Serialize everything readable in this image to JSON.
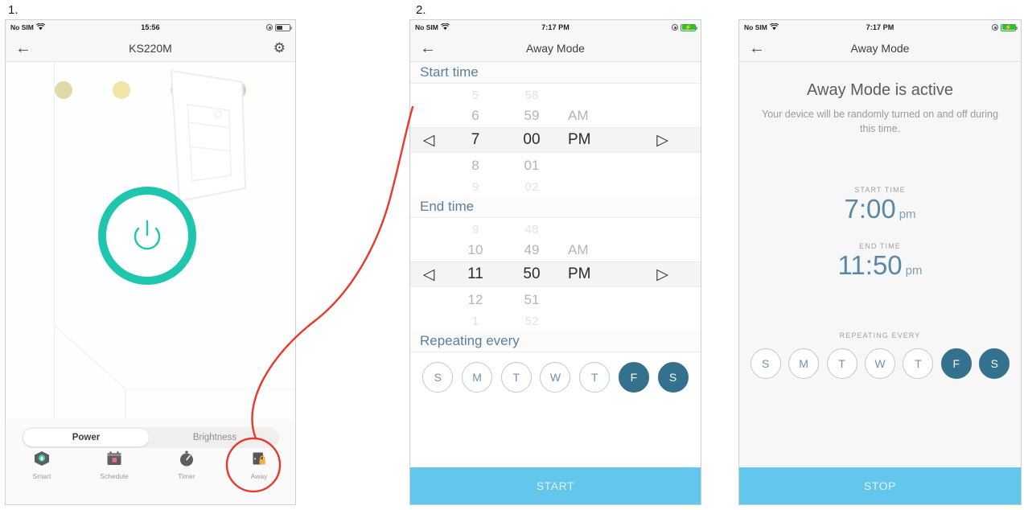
{
  "steps": [
    {
      "label": "1."
    },
    {
      "label": "2."
    }
  ],
  "accent": {
    "teal": "#1fc5ac",
    "blue_header": "#5b7f9c",
    "day_on": "#34718f",
    "cta": "#63c6ec",
    "annotation_red": "#e8392c",
    "time_blue": "#5b87a8"
  },
  "screen1": {
    "status": {
      "carrier": "No SIM",
      "wifi_icon": "wifi-icon",
      "time": "15:56",
      "location_icon": "location-icon",
      "battery_icon": "battery-icon",
      "battery_level": 40
    },
    "nav": {
      "back_icon": "back-arrow-icon",
      "title": "KS220M",
      "settings_icon": "gear-icon"
    },
    "illustration": {
      "device_icon": "wall-outlet-illustration",
      "power_icon": "power-symbol-icon",
      "dots": [
        "#e2d9a8",
        "#f2e3a6",
        "#eadfa6",
        "#d6d3bb"
      ]
    },
    "segmented": {
      "options": [
        "Power",
        "Brightness"
      ],
      "selected": "Power"
    },
    "tabs": [
      {
        "label": "Smart",
        "icon": "smart-cube-icon"
      },
      {
        "label": "Schedule",
        "icon": "calendar-icon"
      },
      {
        "label": "Timer",
        "icon": "stopwatch-icon"
      },
      {
        "label": "Away",
        "icon": "away-lock-icon"
      }
    ],
    "highlighted_tab": "Away"
  },
  "screen2": {
    "status": {
      "carrier": "No SIM",
      "wifi_icon": "wifi-icon",
      "time": "7:17 PM",
      "location_icon": "location-icon",
      "battery_icon": "battery-charging-icon"
    },
    "nav": {
      "back_icon": "back-arrow-icon",
      "title": "Away Mode"
    },
    "start_time": {
      "header": "Start time",
      "left_arrow": "◁",
      "right_arrow": "▷",
      "rows": [
        {
          "hour": "5",
          "minute": "58",
          "ampm": "",
          "state": "far"
        },
        {
          "hour": "6",
          "minute": "59",
          "ampm": "AM",
          "state": "near"
        },
        {
          "hour": "7",
          "minute": "00",
          "ampm": "PM",
          "state": "selected"
        },
        {
          "hour": "8",
          "minute": "01",
          "ampm": "",
          "state": "near"
        },
        {
          "hour": "9",
          "minute": "02",
          "ampm": "",
          "state": "far"
        }
      ]
    },
    "end_time": {
      "header": "End time",
      "left_arrow": "◁",
      "right_arrow": "▷",
      "rows": [
        {
          "hour": "9",
          "minute": "48",
          "ampm": "",
          "state": "far"
        },
        {
          "hour": "10",
          "minute": "49",
          "ampm": "AM",
          "state": "near"
        },
        {
          "hour": "11",
          "minute": "50",
          "ampm": "PM",
          "state": "selected"
        },
        {
          "hour": "12",
          "minute": "51",
          "ampm": "",
          "state": "near"
        },
        {
          "hour": "1",
          "minute": "52",
          "ampm": "",
          "state": "far"
        }
      ]
    },
    "repeating": {
      "header": "Repeating every",
      "days": [
        {
          "letter": "S",
          "selected": false
        },
        {
          "letter": "M",
          "selected": false
        },
        {
          "letter": "T",
          "selected": false
        },
        {
          "letter": "W",
          "selected": false
        },
        {
          "letter": "T",
          "selected": false
        },
        {
          "letter": "F",
          "selected": true
        },
        {
          "letter": "S",
          "selected": true
        }
      ]
    },
    "cta": {
      "label": "START"
    }
  },
  "screen3": {
    "status": {
      "carrier": "No SIM",
      "wifi_icon": "wifi-icon",
      "time": "7:17 PM",
      "location_icon": "location-icon",
      "battery_icon": "battery-charging-icon"
    },
    "nav": {
      "back_icon": "back-arrow-icon",
      "title": "Away Mode"
    },
    "title": "Away Mode is active",
    "subtitle": "Your device will be randomly turned on and off during this time.",
    "start_time": {
      "label": "START TIME",
      "hour": "7",
      "sep": ":",
      "minute": "00",
      "ampm": "pm"
    },
    "end_time": {
      "label": "END TIME",
      "hour": "11",
      "sep": ":",
      "minute": "50",
      "ampm": "pm"
    },
    "repeating": {
      "header": "REPEATING EVERY",
      "days": [
        {
          "letter": "S",
          "selected": false
        },
        {
          "letter": "M",
          "selected": false
        },
        {
          "letter": "T",
          "selected": false
        },
        {
          "letter": "W",
          "selected": false
        },
        {
          "letter": "T",
          "selected": false
        },
        {
          "letter": "F",
          "selected": true
        },
        {
          "letter": "S",
          "selected": true
        }
      ]
    },
    "cta": {
      "label": "STOP"
    }
  },
  "annotation": {
    "type": "red-callout-arrow",
    "circle_target": "away-tab-icon",
    "color": "#e8392c"
  }
}
